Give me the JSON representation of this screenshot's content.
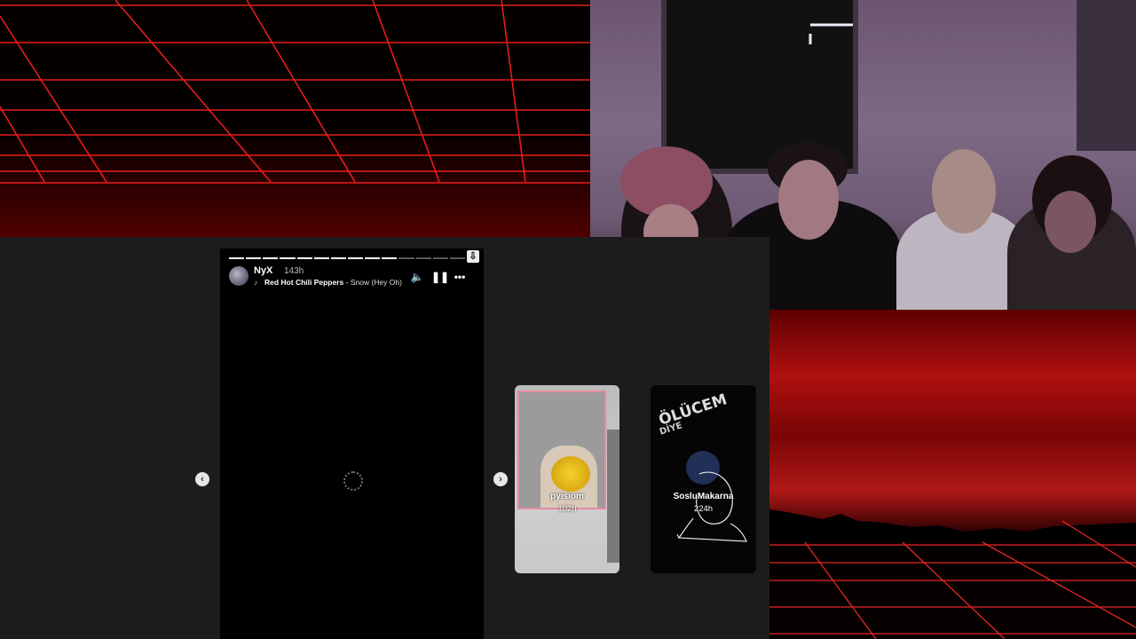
{
  "story": {
    "user_name": "NyX",
    "time_ago": "143h",
    "song_artist": "Red Hot Chili Peppers",
    "song_sep": " - ",
    "song_name": "Snow (Hey Oh)",
    "progress_segments_total": 14,
    "progress_segments_done": 10
  },
  "controls": {
    "mute_icon": "speaker-icon",
    "pause_icon": "pause-icon",
    "more_icon": "more-icon",
    "download_icon": "download-icon",
    "prev_icon": "chevron-left-icon",
    "next_icon": "chevron-right-icon"
  },
  "previews": [
    {
      "name": "pyisiom",
      "time": "102h"
    },
    {
      "name": "SosluMakarna",
      "time": "224h",
      "sticker_text": "ÖLÜCEM",
      "sticker_sub": "DİYE"
    }
  ],
  "colors": {
    "grid_line": "#ff2a2a",
    "accent_pink": "#e58b9e",
    "viewer_bg": "#000000",
    "page_bg": "#1c1c1c"
  }
}
